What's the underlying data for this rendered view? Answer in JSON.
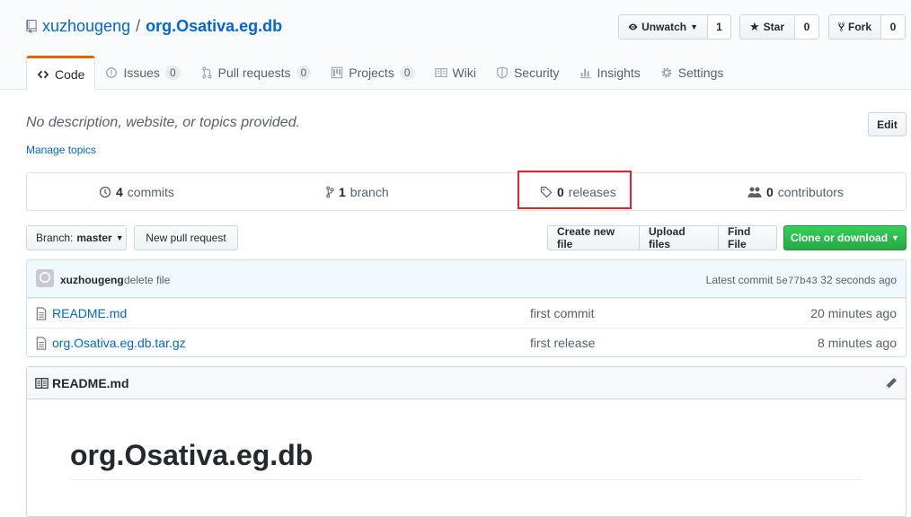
{
  "repo": {
    "owner": "xuzhougeng",
    "separator": "/",
    "name": "org.Osativa.eg.db"
  },
  "actions": {
    "watch": {
      "label": "Unwatch",
      "count": "1"
    },
    "star": {
      "label": "Star",
      "count": "0"
    },
    "fork": {
      "label": "Fork",
      "count": "0"
    }
  },
  "tabs": [
    {
      "label": "Code",
      "icon": "code-icon"
    },
    {
      "label": "Issues",
      "badge": "0",
      "icon": "issue-icon"
    },
    {
      "label": "Pull requests",
      "badge": "0",
      "icon": "pull-request-icon"
    },
    {
      "label": "Projects",
      "badge": "0",
      "icon": "project-icon"
    },
    {
      "label": "Wiki",
      "icon": "wiki-icon"
    },
    {
      "label": "Security",
      "icon": "shield-icon"
    },
    {
      "label": "Insights",
      "icon": "graph-icon"
    },
    {
      "label": "Settings",
      "icon": "gear-icon"
    }
  ],
  "about": {
    "description": "No description, website, or topics provided.",
    "manage_topics": "Manage topics",
    "edit_label": "Edit"
  },
  "summary": {
    "commits": {
      "count": "4",
      "label": "commits"
    },
    "branches": {
      "count": "1",
      "label": "branch"
    },
    "releases": {
      "count": "0",
      "label": "releases"
    },
    "contributors": {
      "count": "0",
      "label": "contributors"
    }
  },
  "toolbar": {
    "branch_prefix": "Branch:",
    "branch_name": "master",
    "new_pr": "New pull request",
    "create_file": "Create new file",
    "upload_files": "Upload files",
    "find_file": "Find File",
    "clone": "Clone or download"
  },
  "latest_commit": {
    "author": "xuzhougeng",
    "message": "delete file",
    "label": "Latest commit",
    "sha": "5e77b43",
    "age": "32 seconds ago"
  },
  "files": [
    {
      "name": "README.md",
      "message": "first commit",
      "age": "20 minutes ago"
    },
    {
      "name": "org.Osativa.eg.db.tar.gz",
      "message": "first release",
      "age": "8 minutes ago"
    }
  ],
  "readme": {
    "title": "README.md",
    "heading": "org.Osativa.eg.db"
  },
  "colors": {
    "accent": "#0366d6",
    "tab_highlight": "#e36209",
    "clone_button": "#28a745",
    "annotation_box": "#e3222d"
  }
}
